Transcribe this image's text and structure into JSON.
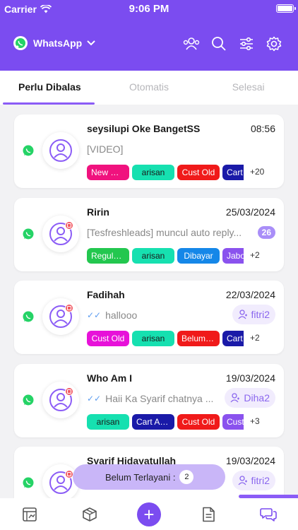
{
  "status_bar": {
    "carrier": "Carrier",
    "time": "9:06 PM"
  },
  "header": {
    "app_name": "WhatsApp",
    "icons": [
      "contacts-icon",
      "search-icon",
      "filter-icon",
      "settings-icon"
    ]
  },
  "tabs": [
    {
      "label": "Perlu Dibalas",
      "active": true
    },
    {
      "label": "Otomatis",
      "active": false
    },
    {
      "label": "Selesai",
      "active": false
    }
  ],
  "conversations": [
    {
      "name": "seysilupi Oke BangetSS",
      "time": "08:56",
      "message": "[VIDEO]",
      "instagram_badge": false,
      "tags": [
        {
          "label": "New Customer",
          "color": "#f0127e"
        },
        {
          "label": "arisan",
          "color": "#16e0b0"
        },
        {
          "label": "Cust Old",
          "color": "#f01a1a"
        },
        {
          "label": "Cart Abandoned",
          "color": "#1a1aa8"
        }
      ],
      "more": "+20"
    },
    {
      "name": "Ririn",
      "time": "25/03/2024",
      "message": "[Tesfreshleads] muncul auto reply...",
      "unread": "26",
      "instagram_badge": true,
      "tags": [
        {
          "label": "Regular Customer",
          "color": "#23c74f"
        },
        {
          "label": "arisan",
          "color": "#16e0b0"
        },
        {
          "label": "Dibayar",
          "color": "#1587e8"
        },
        {
          "label": "Jabodetabek",
          "color": "#8a52ee"
        }
      ],
      "more": "+2"
    },
    {
      "name": "Fadihah",
      "time": "22/03/2024",
      "message": "hallooo",
      "ticks": "✓✓",
      "agent": "fitri2",
      "instagram_badge": true,
      "tags": [
        {
          "label": "Cust Old",
          "color": "#e711d9"
        },
        {
          "label": "arisan",
          "color": "#16e0b0"
        },
        {
          "label": "Belum Bayar",
          "color": "#f01a1a"
        },
        {
          "label": "Cart Abandoned",
          "color": "#1a1aa8"
        }
      ],
      "more": "+2"
    },
    {
      "name": "Who Am I",
      "time": "19/03/2024",
      "message": "Haii Ka Syarif chatnya ...",
      "ticks": "✓✓",
      "agent": "Diha2",
      "instagram_badge": true,
      "tags": [
        {
          "label": "arisan",
          "color": "#16e0b0"
        },
        {
          "label": "Cart Abandoned",
          "color": "#1a1aa8"
        },
        {
          "label": "Cust Old",
          "color": "#f01a1a"
        },
        {
          "label": "Cust Jabodetabek",
          "color": "#8a52ee"
        }
      ],
      "more": "+3"
    },
    {
      "name": "Syarif Hidayatullah",
      "time": "19/03/2024",
      "message": "",
      "agent": "fitri2",
      "instagram_badge": true,
      "tags": [],
      "more": ""
    }
  ],
  "floating_badge": {
    "label": "Belum Terlayani :",
    "count": "2"
  },
  "bottom_nav": [
    {
      "icon": "dashboard-icon"
    },
    {
      "icon": "box-icon"
    },
    {
      "icon": "add-icon",
      "label": "+"
    },
    {
      "icon": "document-icon"
    },
    {
      "icon": "chat-icon",
      "active": true
    }
  ],
  "colors": {
    "accent": "#7b4cf0",
    "whatsapp": "#25d366"
  }
}
